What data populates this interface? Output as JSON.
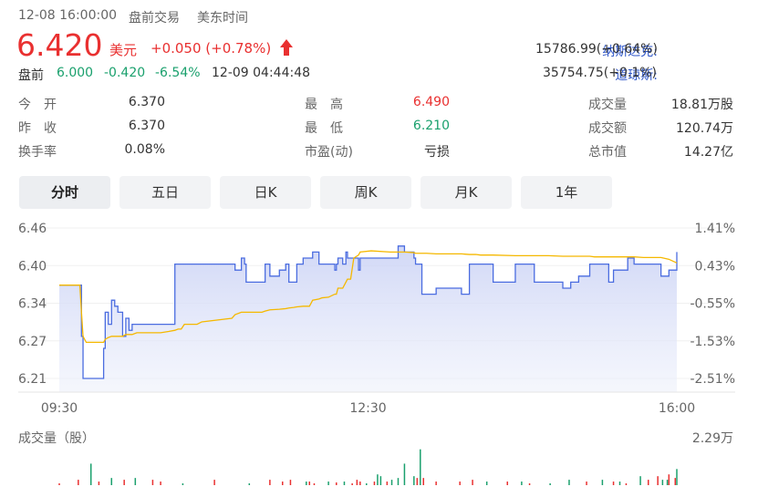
{
  "colors": {
    "up": "#e93030",
    "down": "#1aa06d",
    "price_line": "#4a6ce0",
    "avg_line": "#f5b800",
    "link": "#2d55c8"
  },
  "header": {
    "datetime": "12-08 16:00:00",
    "session": "盘前交易",
    "timezone": "美东时间",
    "price": "6.420",
    "currency": "美元",
    "change": "+0.050 (+0.78%)",
    "arrow_icon": "up-arrow-icon",
    "premarket_label": "盘前",
    "premarket_price": "6.000",
    "premarket_change": "-0.420",
    "premarket_pct": "-6.54%",
    "premarket_time": "12-09 04:44:48"
  },
  "indices": [
    {
      "name": "纳斯达克:",
      "value": "15786.99(+0.64%)"
    },
    {
      "name": "道琼斯:",
      "value": "35754.75(+0.1%)"
    }
  ],
  "stats": {
    "open_label": "今　开",
    "open": "6.370",
    "prev_close_label": "昨　收",
    "prev_close": "6.370",
    "turnover_label": "换手率",
    "turnover": "0.08%",
    "high_label": "最　高",
    "high": "6.490",
    "low_label": "最　低",
    "low": "6.210",
    "pe_label": "市盈(动)",
    "pe": "亏损",
    "volume_label": "成交量",
    "volume": "18.81万股",
    "amount_label": "成交额",
    "amount": "120.74万",
    "mktcap_label": "总市值",
    "mktcap": "14.27亿"
  },
  "tabs": [
    "分时",
    "五日",
    "日K",
    "周K",
    "月K",
    "1年"
  ],
  "chart_data": {
    "type": "line",
    "y_ticks": [
      "6.46",
      "6.40",
      "6.34",
      "6.27",
      "6.21"
    ],
    "pct_ticks": [
      "1.41%",
      "0.43%",
      "-0.55%",
      "-1.53%",
      "-2.51%"
    ],
    "x_ticks": [
      "09:30",
      "12:30",
      "16:00"
    ],
    "ylim": [
      6.21,
      6.46
    ],
    "x": [
      0,
      12,
      13,
      14,
      15,
      17,
      24,
      27,
      28,
      29,
      31,
      33,
      35,
      37,
      40,
      42,
      44,
      46,
      49,
      51,
      64,
      69,
      73,
      75,
      77,
      78,
      79,
      87,
      90,
      109,
      111,
      115,
      117,
      118,
      119,
      120,
      128,
      130,
      133,
      139,
      143,
      145,
      148,
      150,
      154,
      158,
      160,
      164,
      166,
      170,
      174,
      175,
      176,
      179,
      181,
      182,
      184,
      186,
      189,
      190,
      197,
      209,
      214,
      218,
      224,
      225,
      229,
      232,
      238,
      245,
      254,
      259,
      263,
      266,
      268,
      274,
      288,
      300,
      309,
      318,
      319,
      323,
      328,
      335,
      338,
      347,
      350,
      354,
      359,
      363,
      369,
      375,
      380,
      385,
      390
    ],
    "series": [
      {
        "values": [
          6.365,
          6.365,
          6.365,
          6.28,
          6.21,
          6.21,
          6.21,
          6.21,
          6.26,
          6.32,
          6.3,
          6.34,
          6.33,
          6.32,
          6.28,
          6.31,
          6.29,
          6.3,
          6.3,
          6.3,
          6.3,
          6.3,
          6.4,
          6.4,
          6.4,
          6.4,
          6.4,
          6.4,
          6.4,
          6.4,
          6.39,
          6.41,
          6.4,
          6.37,
          6.37,
          6.37,
          6.37,
          6.4,
          6.38,
          6.39,
          6.4,
          6.37,
          6.37,
          6.4,
          6.41,
          6.41,
          6.42,
          6.4,
          6.4,
          6.4,
          6.39,
          6.4,
          6.41,
          6.4,
          6.42,
          6.41,
          6.41,
          6.41,
          6.39,
          6.41,
          6.41,
          6.41,
          6.43,
          6.42,
          6.41,
          6.4,
          6.35,
          6.35,
          6.36,
          6.36,
          6.35,
          6.4,
          6.4,
          6.4,
          6.4,
          6.37,
          6.4,
          6.37,
          6.37,
          6.36,
          6.36,
          6.37,
          6.38,
          6.4,
          6.4,
          6.37,
          6.39,
          6.39,
          6.41,
          6.4,
          6.4,
          6.4,
          6.38,
          6.39,
          6.42
        ]
      },
      {
        "values": [
          6.365,
          6.365,
          6.365,
          6.32,
          6.28,
          6.27,
          6.27,
          6.27,
          6.27,
          6.275,
          6.278,
          6.28,
          6.28,
          6.28,
          6.28,
          6.283,
          6.283,
          6.283,
          6.286,
          6.286,
          6.286,
          6.288,
          6.29,
          6.292,
          6.292,
          6.296,
          6.3,
          6.3,
          6.304,
          6.31,
          6.316,
          6.32,
          6.32,
          6.32,
          6.32,
          6.32,
          6.32,
          6.322,
          6.324,
          6.325,
          6.326,
          6.327,
          6.328,
          6.329,
          6.33,
          6.33,
          6.34,
          6.342,
          6.344,
          6.345,
          6.35,
          6.35,
          6.36,
          6.36,
          6.37,
          6.375,
          6.375,
          6.41,
          6.415,
          6.42,
          6.422,
          6.42,
          6.42,
          6.42,
          6.419,
          6.418,
          6.418,
          6.418,
          6.417,
          6.417,
          6.417,
          6.416,
          6.416,
          6.415,
          6.415,
          6.415,
          6.414,
          6.414,
          6.414,
          6.413,
          6.413,
          6.413,
          6.413,
          6.413,
          6.412,
          6.412,
          6.412,
          6.412,
          6.412,
          6.412,
          6.411,
          6.411,
          6.411,
          6.408,
          6.402
        ]
      }
    ],
    "volume": {
      "label": "成交量（股）",
      "max_label": "2.29万",
      "x": [
        0,
        12,
        20,
        25,
        33,
        41,
        48,
        59,
        64,
        78,
        98,
        120,
        133,
        141,
        146,
        156,
        158,
        161,
        170,
        175,
        180,
        185,
        188,
        190,
        194,
        199,
        201,
        203,
        207,
        210,
        214,
        218,
        224,
        226,
        228,
        230,
        238,
        253,
        261,
        270,
        283,
        292,
        297,
        310,
        322,
        333,
        343,
        350,
        354,
        358,
        367,
        372,
        378,
        381,
        384,
        385,
        389,
        390
      ],
      "values": [
        0.1,
        0.3,
        1.2,
        0.2,
        0.4,
        0.3,
        0.4,
        0.3,
        0.2,
        0.1,
        0.3,
        0.1,
        0.3,
        0.2,
        0.3,
        0.2,
        0.2,
        0.1,
        0.2,
        0.15,
        0.2,
        0.1,
        0.3,
        0.2,
        0.1,
        0.2,
        0.6,
        0.5,
        0.2,
        0.3,
        0.4,
        1.2,
        0.5,
        0.4,
        2.0,
        0.4,
        0.2,
        0.2,
        0.3,
        0.2,
        0.2,
        0.2,
        0.1,
        0.1,
        0.3,
        0.2,
        0.3,
        0.2,
        0.2,
        0.1,
        0.5,
        0.3,
        0.5,
        0.3,
        0.3,
        0.6,
        0.4,
        0.9
      ],
      "up": [
        false,
        false,
        true,
        false,
        true,
        false,
        true,
        false,
        false,
        true,
        false,
        true,
        false,
        false,
        false,
        true,
        false,
        false,
        true,
        false,
        true,
        false,
        false,
        false,
        true,
        false,
        true,
        true,
        false,
        true,
        true,
        true,
        true,
        false,
        true,
        false,
        false,
        false,
        false,
        true,
        false,
        true,
        false,
        true,
        true,
        false,
        true,
        false,
        true,
        false,
        true,
        false,
        false,
        true,
        true,
        false,
        false,
        true
      ]
    }
  }
}
